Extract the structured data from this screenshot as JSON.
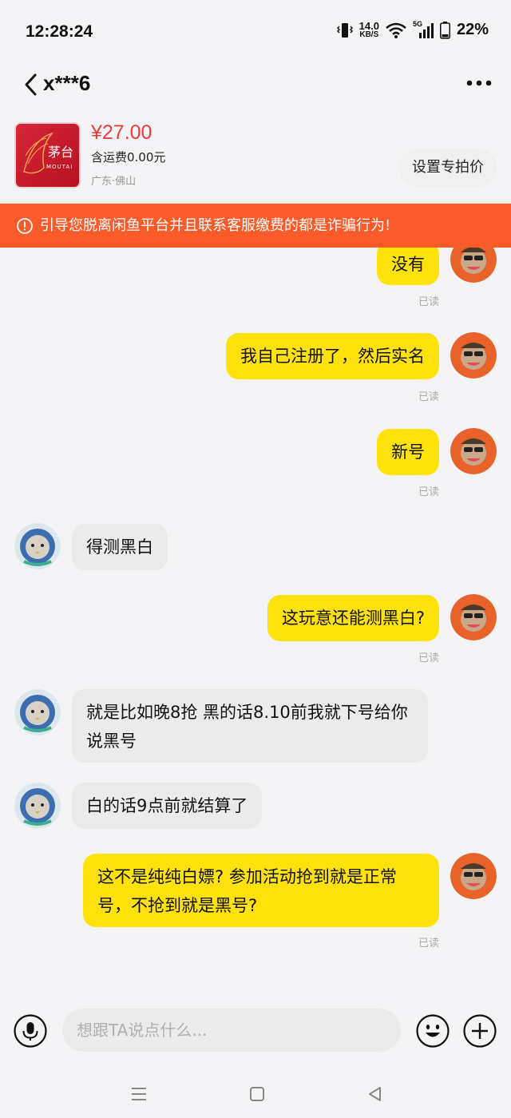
{
  "status_bar": {
    "time": "12:28:24",
    "net_speed_value": "14.0",
    "net_speed_unit": "KB/S",
    "network_label": "5G",
    "battery": "22%"
  },
  "header": {
    "title": "x***6"
  },
  "product": {
    "logo_text": "茅台",
    "logo_subtext": "MOUTAI",
    "price": "¥27.00",
    "shipping": "含运费0.00元",
    "location": "广东·佛山",
    "set_price_label": "设置专拍价"
  },
  "warning": {
    "text": "引导您脱离闲鱼平台并且联系客服缴费的都是诈骗行为!"
  },
  "messages": [
    {
      "side": "out",
      "text": "没有",
      "status": "已读"
    },
    {
      "side": "out",
      "text": "我自己注册了，然后实名",
      "status": "已读"
    },
    {
      "side": "out",
      "text": "新号",
      "status": "已读"
    },
    {
      "side": "in",
      "text": "得测黑白"
    },
    {
      "side": "out",
      "text": "这玩意还能测黑白?",
      "status": "已读"
    },
    {
      "side": "in",
      "text": "就是比如晚8抢 黑的话8.10前我就下号给你说黑号"
    },
    {
      "side": "in",
      "text": "白的话9点前就结算了"
    },
    {
      "side": "out",
      "text": "这不是纯纯白嫖? 参加活动抢到就是正常号，不抢到就是黑号?",
      "status": "已读"
    }
  ],
  "input": {
    "placeholder": "想跟TA说点什么..."
  },
  "colors": {
    "out_bubble": "#ffe20b",
    "in_bubble": "#ebebeb",
    "warning_bg": "#fb5a29",
    "price": "#ee3b3b"
  }
}
